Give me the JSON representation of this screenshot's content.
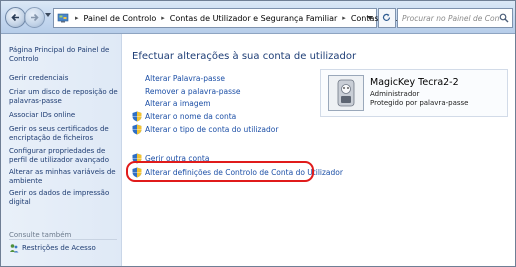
{
  "address": {
    "crumbs": [
      "Painel de Controlo",
      "Contas de Utilizador e Segurança Familiar",
      "Contas de Utilizador"
    ],
    "search_placeholder": "Procurar no Painel de Contro..."
  },
  "sidebar": {
    "home": "Página Principal do Painel de Controlo",
    "links": [
      "Gerir credenciais",
      "Criar um disco de reposição de palavras-passe",
      "Associar IDs online",
      "Gerir os seus certificados de encriptação de ficheiros",
      "Configurar propriedades de perfil de utilizador avançado",
      "Alterar as minhas variáveis de ambiente",
      "Gerir os dados de impressão digital"
    ],
    "see_also": "Consulte também",
    "parental": "Restrições de Acesso"
  },
  "main": {
    "heading": "Efectuar alterações à sua conta de utilizador",
    "tasks": [
      "Alterar Palavra-passe",
      "Remover a palavra-passe",
      "Alterar a imagem",
      "Alterar o nome da conta",
      "Alterar o tipo de conta do utilizador"
    ],
    "other_tasks": [
      "Gerir outra conta",
      "Alterar definições de Controlo de Conta do Utilizador"
    ]
  },
  "user": {
    "name": "MagicKey Tecra2-2",
    "role": "Administrador",
    "protection": "Protegido por palavra-passe"
  },
  "colors": {
    "link": "#1c4fa6",
    "heading": "#1d3d76",
    "highlight": "#e01b1b",
    "sidebar_bg": "#e4edf8"
  }
}
